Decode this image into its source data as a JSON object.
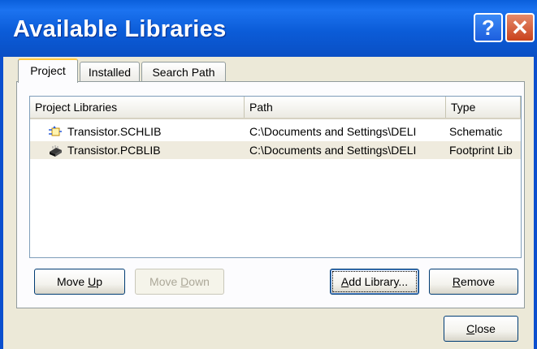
{
  "window": {
    "title": "Available Libraries",
    "help_glyph": "?",
    "close_glyph": "✕"
  },
  "tabs": [
    {
      "label": "Project",
      "active": true
    },
    {
      "label": "Installed",
      "active": false
    },
    {
      "label": "Search Path",
      "active": false
    }
  ],
  "table": {
    "columns": [
      "Project Libraries",
      "Path",
      "Type"
    ],
    "rows": [
      {
        "name": "Transistor.SCHLIB",
        "path": "C:\\Documents and Settings\\DELI",
        "type": "Schematic",
        "icon": "schematic-library-icon",
        "selected": false
      },
      {
        "name": "Transistor.PCBLIB",
        "path": "C:\\Documents and Settings\\DELI",
        "type": "Footprint Lib",
        "icon": "pcb-library-icon",
        "selected": true
      }
    ]
  },
  "buttons": {
    "move_up": {
      "pre": "Move ",
      "key": "U",
      "post": "p",
      "enabled": true
    },
    "move_down": {
      "pre": "Move ",
      "key": "D",
      "post": "own",
      "enabled": false
    },
    "add_library": {
      "pre": "",
      "key": "A",
      "post": "dd Library...",
      "enabled": true
    },
    "remove": {
      "pre": "",
      "key": "R",
      "post": "emove",
      "enabled": true
    },
    "close": {
      "pre": "",
      "key": "C",
      "post": "lose",
      "enabled": true
    }
  },
  "colors": {
    "titlebar": "#0A5FDB",
    "tab_active_border": "#FFC83C",
    "selected_row": "#EFEBDE"
  }
}
